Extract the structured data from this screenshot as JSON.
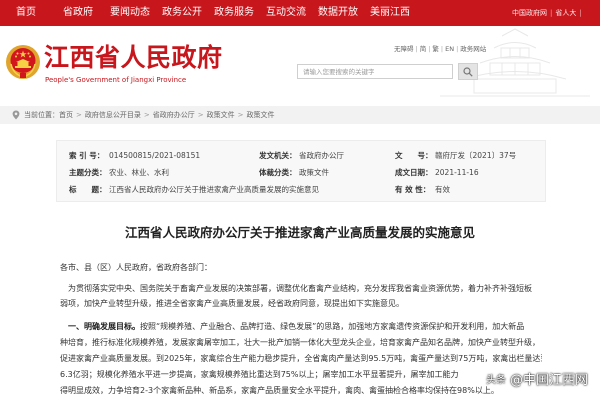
{
  "colors": {
    "brand_red": "#c8161d",
    "nav_text": "#ffffff",
    "breadcrumb_bg": "#f2f2f2"
  },
  "icons": {
    "logo": "national-emblem-icon",
    "breadcrumb": "location-pin-icon",
    "search": "search-icon"
  },
  "top_nav": {
    "items": [
      "首页",
      "省政府",
      "要闻动态",
      "政务公开",
      "政务服务",
      "互动交流",
      "数据开放",
      "美丽江西"
    ],
    "right_links": [
      "中国政府网",
      "省人大"
    ],
    "separator": "|"
  },
  "header": {
    "site_title": "江西省人民政府",
    "site_subtitle": "People's Government of Jiangxi Province",
    "tool_links": [
      "无障碍",
      "简",
      "繁",
      "EN",
      "政务网站"
    ],
    "tool_separator": "|",
    "search": {
      "placeholder": "请输入您要搜索的关键字"
    }
  },
  "breadcrumb": {
    "prefix": "当前位置：",
    "items": [
      "首页",
      "政府信息公开目录",
      "省政府办公厅",
      "政策文件",
      "政策文件"
    ],
    "separator": ">"
  },
  "meta": {
    "rows": [
      [
        {
          "label": "索 引 号：",
          "value": "014500815/2021-08151"
        },
        {
          "label": "发文机关：",
          "value": "省政府办公厅"
        },
        {
          "label": "文　　号：",
          "value": "赣府厅发〔2021〕37号"
        }
      ],
      [
        {
          "label": "主题分类：",
          "value": "农业、林业、水利"
        },
        {
          "label": "体裁分类：",
          "value": "政策文件"
        },
        {
          "label": "成文日期：",
          "value": "2021-11-16"
        }
      ],
      [
        {
          "label": "标　　题：",
          "value": "江西省人民政府办公厅关于推进家禽产业高质量发展的实施意见"
        },
        {
          "label": "有 效 性：",
          "value": "有效"
        }
      ]
    ]
  },
  "article": {
    "title": "江西省人民政府办公厅关于推进家禽产业高质量发展的实施意见",
    "salutation": "各市、县（区）人民政府，省政府各部门：",
    "para1_lines": [
      "为贯彻落实党中央、国务院关于畜禽产业发展的决策部署，调整优化畜禽产业结构，充分发挥我省禽业资源优势，着力补齐补强短板",
      "弱项，加快产业转型升级，推进全省家禽产业高质量发展，经省政府同意，现提出如下实施意见。"
    ],
    "para2_lead": "一、明确发展目标。",
    "para2_lines": [
      "按照“规模养殖、产业融合、品牌打造、绿色发展”的思路，加强地方家禽遗传资源保护和开发利用，加大新品",
      "种培育，推行标准化规模养殖，发展家禽屠宰加工，壮大一批产加销一体化大型龙头企业，培育家禽产品知名品牌，加快产业转型升级，",
      "促进家禽产业高质量发展。到2025年，家禽综合生产能力稳步提升，全省禽肉产量达到95.5万吨，禽蛋产量达到75万吨，家禽出栏量达到",
      "6.3亿羽；规模化养殖水平进一步提高，家禽规模养殖比重达到75%以上；屠宰加工水平显著提升，屠宰加工能力",
      "得明显成效，力争培育2-3个家禽新品种、新品系，家禽产品质量安全水平提升，禽肉、禽蛋抽检合格率均保持在98%以上。"
    ]
  },
  "watermark": {
    "platform": "头条",
    "account": "@中国江西网"
  }
}
